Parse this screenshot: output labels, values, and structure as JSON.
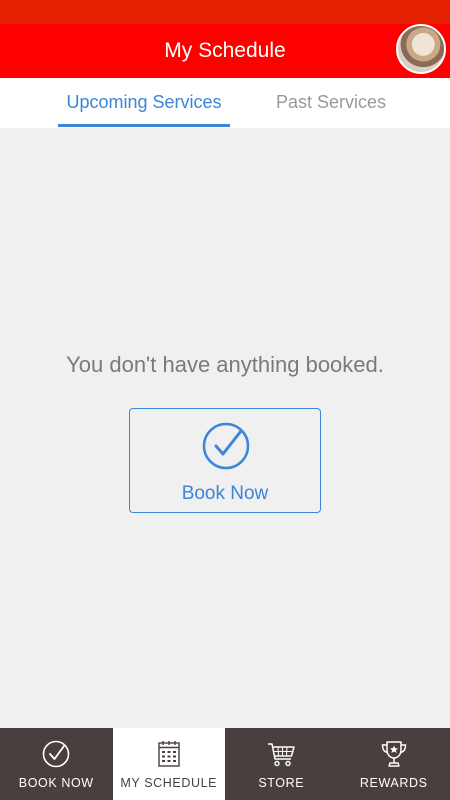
{
  "header": {
    "title": "My Schedule"
  },
  "tabs": [
    {
      "label": "Upcoming Services",
      "active": true
    },
    {
      "label": "Past Services",
      "active": false
    }
  ],
  "empty_state": {
    "message": "You don't have anything booked.",
    "button_label": "Book Now"
  },
  "bottom_nav": [
    {
      "label": "BOOK NOW",
      "icon": "check-circle-icon",
      "active": false
    },
    {
      "label": "MY SCHEDULE",
      "icon": "calendar-icon",
      "active": true
    },
    {
      "label": "STORE",
      "icon": "cart-icon",
      "active": false
    },
    {
      "label": "REWARDS",
      "icon": "trophy-icon",
      "active": false
    }
  ],
  "colors": {
    "header": "#ff0000",
    "status_bar": "#e52000",
    "accent": "#3a86d8",
    "nav_background": "#4a3f3f",
    "content_background": "#f0f0f0"
  }
}
